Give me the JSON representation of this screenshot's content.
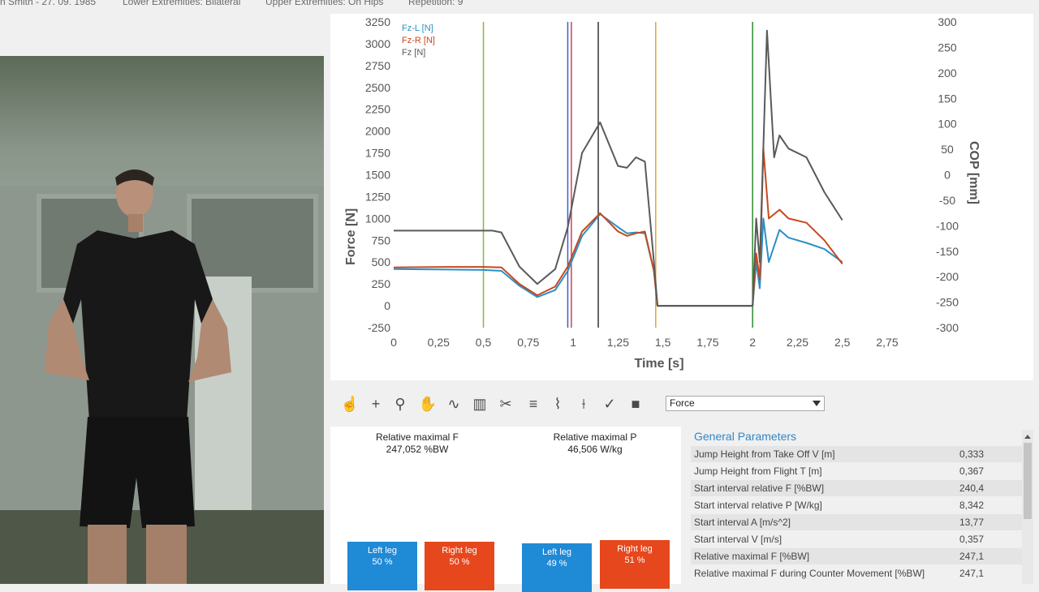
{
  "header": {
    "patient": "n Smith - 27. 09. 1985",
    "lower_extremities": "Lower Extremities: Bilateral",
    "upper_extremities": "Upper Extremities: On Hips",
    "repetition": "Repetition: 9"
  },
  "toolbar": {
    "icons": [
      "hand-touch-icon",
      "crosshair-icon",
      "zoom-icon",
      "pan-hand-icon",
      "waveform-icon",
      "bar-chart-icon",
      "scissors-icon",
      "menu-lines-icon",
      "signal-icon",
      "axis-icon",
      "check-wave-icon",
      "camera-icon"
    ],
    "view_select": "Force"
  },
  "results": {
    "rel_max_f_label": "Relative maximal F",
    "rel_max_f_value": "247,052 %BW",
    "rel_max_p_label": "Relative maximal P",
    "rel_max_p_value": "46,506 W/kg",
    "f_left_label": "Left leg",
    "f_left_value": "50 %",
    "f_right_label": "Right leg",
    "f_right_value": "50 %",
    "p_left_label": "Left leg",
    "p_left_value": "49 %",
    "p_right_label": "Right leg",
    "p_right_value": "51 %"
  },
  "params": {
    "title": "General Parameters",
    "rows": [
      {
        "name": "Jump Height from Take Off V [m]",
        "value": "0,333"
      },
      {
        "name": "Jump Height from Flight T [m]",
        "value": "0,367"
      },
      {
        "name": "Start interval relative F [%BW]",
        "value": "240,4"
      },
      {
        "name": "Start interval relative P [W/kg]",
        "value": "8,342"
      },
      {
        "name": "Start interval A [m/s^2]",
        "value": "13,77"
      },
      {
        "name": "Start interval V [m/s]",
        "value": "0,357"
      },
      {
        "name": "Relative maximal F [%BW]",
        "value": "247,1"
      },
      {
        "name": "Relative maximal F during Counter Movement [%BW]",
        "value": "247,1"
      }
    ]
  },
  "chart_data": {
    "type": "line",
    "xlabel": "Time [s]",
    "ylabel": "Force [N]",
    "y2label": "COP [mm]",
    "xlim": [
      0,
      2.75
    ],
    "ylim": [
      -250,
      3250
    ],
    "y2lim": [
      -300,
      300
    ],
    "x_ticks": [
      "0",
      "0,25",
      "0,5",
      "0,75",
      "1",
      "1,25",
      "1,5",
      "1,75",
      "2",
      "2,25",
      "2,5",
      "2,75"
    ],
    "y_ticks": [
      "3250",
      "3000",
      "2750",
      "2500",
      "2250",
      "2000",
      "1750",
      "1500",
      "1250",
      "1000",
      "750",
      "500",
      "250",
      "0",
      "-250"
    ],
    "y2_ticks": [
      "300",
      "250",
      "200",
      "150",
      "100",
      "50",
      "0",
      "-50",
      "-100",
      "-150",
      "-200",
      "-250",
      "-300"
    ],
    "legend": [
      "Fz-L [N]",
      "Fz-R [N]",
      "Fz [N]"
    ],
    "series": [
      {
        "name": "Fz-L [N]",
        "color": "#2b8fc6",
        "points": [
          [
            0,
            420
          ],
          [
            0.3,
            415
          ],
          [
            0.5,
            410
          ],
          [
            0.6,
            400
          ],
          [
            0.7,
            230
          ],
          [
            0.8,
            100
          ],
          [
            0.9,
            180
          ],
          [
            0.97,
            400
          ],
          [
            1.05,
            800
          ],
          [
            1.15,
            1050
          ],
          [
            1.25,
            900
          ],
          [
            1.3,
            830
          ],
          [
            1.35,
            840
          ],
          [
            1.4,
            830
          ],
          [
            1.45,
            400
          ],
          [
            1.47,
            0
          ],
          [
            1.5,
            0
          ],
          [
            2.0,
            0
          ],
          [
            2.02,
            500
          ],
          [
            2.04,
            200
          ],
          [
            2.06,
            1000
          ],
          [
            2.09,
            500
          ],
          [
            2.15,
            870
          ],
          [
            2.2,
            780
          ],
          [
            2.3,
            720
          ],
          [
            2.4,
            650
          ],
          [
            2.5,
            500
          ]
        ]
      },
      {
        "name": "Fz-R [N]",
        "color": "#c8481c",
        "points": [
          [
            0,
            440
          ],
          [
            0.3,
            445
          ],
          [
            0.5,
            445
          ],
          [
            0.6,
            440
          ],
          [
            0.7,
            250
          ],
          [
            0.8,
            120
          ],
          [
            0.9,
            220
          ],
          [
            0.97,
            450
          ],
          [
            1.05,
            850
          ],
          [
            1.15,
            1060
          ],
          [
            1.25,
            850
          ],
          [
            1.3,
            800
          ],
          [
            1.35,
            830
          ],
          [
            1.4,
            850
          ],
          [
            1.45,
            400
          ],
          [
            1.47,
            0
          ],
          [
            1.5,
            0
          ],
          [
            2.0,
            0
          ],
          [
            2.02,
            600
          ],
          [
            2.04,
            300
          ],
          [
            2.06,
            1800
          ],
          [
            2.09,
            1000
          ],
          [
            2.15,
            1100
          ],
          [
            2.2,
            1000
          ],
          [
            2.3,
            950
          ],
          [
            2.4,
            750
          ],
          [
            2.5,
            480
          ]
        ]
      },
      {
        "name": "Fz [N]",
        "color": "#5a5a5a",
        "points": [
          [
            0,
            860
          ],
          [
            0.3,
            860
          ],
          [
            0.55,
            860
          ],
          [
            0.6,
            840
          ],
          [
            0.7,
            450
          ],
          [
            0.8,
            250
          ],
          [
            0.9,
            420
          ],
          [
            0.97,
            900
          ],
          [
            1.05,
            1750
          ],
          [
            1.15,
            2100
          ],
          [
            1.2,
            1850
          ],
          [
            1.25,
            1600
          ],
          [
            1.3,
            1580
          ],
          [
            1.35,
            1700
          ],
          [
            1.4,
            1650
          ],
          [
            1.45,
            500
          ],
          [
            1.47,
            0
          ],
          [
            1.5,
            0
          ],
          [
            2.0,
            0
          ],
          [
            2.02,
            1000
          ],
          [
            2.04,
            500
          ],
          [
            2.08,
            3150
          ],
          [
            2.12,
            1700
          ],
          [
            2.15,
            1950
          ],
          [
            2.2,
            1800
          ],
          [
            2.3,
            1700
          ],
          [
            2.4,
            1300
          ],
          [
            2.5,
            980
          ]
        ]
      }
    ],
    "markers": [
      {
        "x": 0.5,
        "color": "#8cb83a"
      },
      {
        "x": 0.97,
        "color": "#3a5fc8"
      },
      {
        "x": 0.99,
        "color": "#d0405a"
      },
      {
        "x": 1.14,
        "color": "#333333"
      },
      {
        "x": 1.46,
        "color": "#e0a73a"
      },
      {
        "x": 2.0,
        "color": "#2e8b2e"
      }
    ]
  }
}
